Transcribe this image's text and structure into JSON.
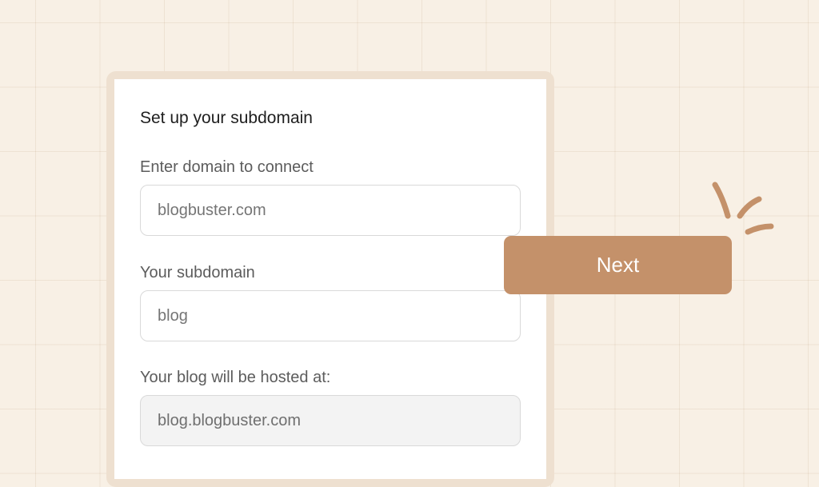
{
  "form": {
    "title": "Set up your subdomain",
    "domain_label": "Enter domain to connect",
    "domain_placeholder": "blogbuster.com",
    "subdomain_label": "Your subdomain",
    "subdomain_placeholder": "blog",
    "hosted_label": "Your blog will be hosted at:",
    "hosted_value": "blog.blogbuster.com"
  },
  "next_button": {
    "label": "Next"
  },
  "decoration": {
    "icon": "sparkle-lines-icon"
  },
  "colors": {
    "background": "#f8f0e5",
    "card_frame": "#eee0d0",
    "card": "#ffffff",
    "accent": "#c4916a",
    "readonly_field": "#f3f3f3"
  }
}
